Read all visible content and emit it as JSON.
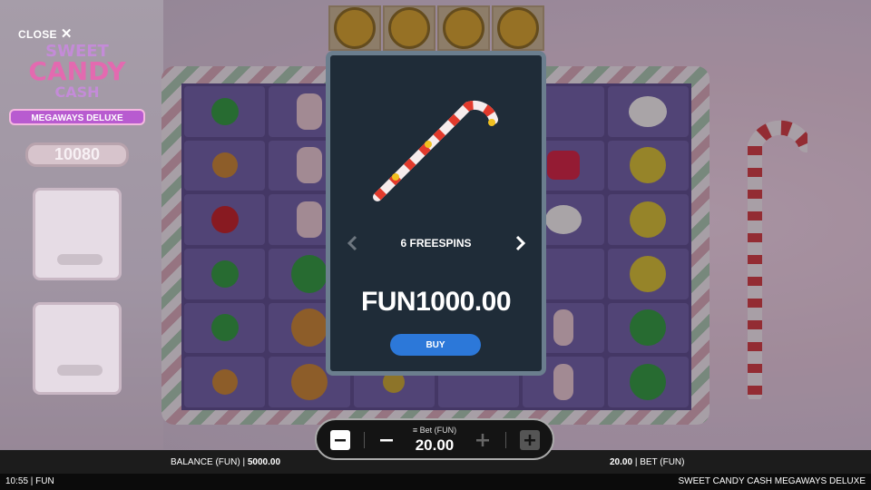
{
  "header": {
    "close_label": "CLOSE"
  },
  "logo": {
    "line1": "SWEET",
    "line2": "CANDY",
    "line3": "CASH",
    "band": "MEGAWAYS DELUXE"
  },
  "counter": {
    "value": "10080"
  },
  "modal": {
    "feature_label": "6 FREESPINS",
    "price": "FUN1000.00",
    "buy_label": "BUY"
  },
  "bet_panel": {
    "label": "Bet (FUN)",
    "value": "20.00"
  },
  "footer": {
    "balance_label": "BALANCE (FUN)",
    "balance_value": "5000.00",
    "bet_value": "20.00",
    "bet_label": "BET (FUN)"
  },
  "status_bar": {
    "time_currency": "10:55 | FUN",
    "game_title": "SWEET CANDY CASH MEGAWAYS DELUXE"
  },
  "colors": {
    "modal_bg": "#1f2c38",
    "modal_border": "#6b7e8e",
    "buy_button": "#2c78d9",
    "grid_bg": "#5a4b86"
  },
  "icons": {
    "close": "close-icon",
    "candy_cane": "candy-cane-icon",
    "prev": "chevron-left-icon",
    "next": "chevron-right-icon",
    "min_bet": "min-bet-icon",
    "decrease": "minus-icon",
    "coins": "coins-icon",
    "increase": "plus-icon",
    "max_bet": "max-bet-icon"
  }
}
